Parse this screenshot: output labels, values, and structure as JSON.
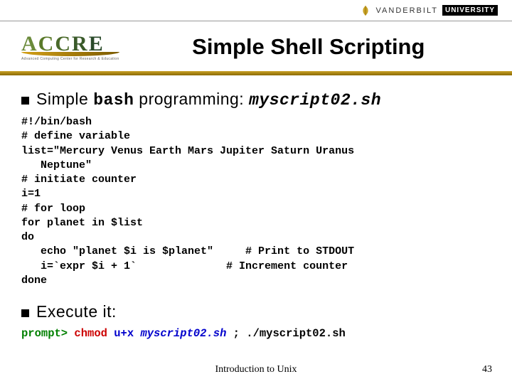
{
  "banner": {
    "vanderbilt": "VANDERBILT",
    "vu": "UNIVERSITY"
  },
  "logo": {
    "name": "ACCRE",
    "sub": "Advanced Computing Center\nfor Research & Education"
  },
  "title": "Simple Shell Scripting",
  "bullet1": {
    "prefix": "Simple ",
    "mono1": "bash",
    "mid": " programming: ",
    "mono2": "myscript02.sh"
  },
  "code": {
    "l1": "#!/bin/bash",
    "l2": "# define variable",
    "l3": "list=\"Mercury Venus Earth Mars Jupiter Saturn Uranus",
    "l3b": "   Neptune\"",
    "l4": "# initiate counter",
    "l5": "i=1",
    "l6": "# for loop",
    "l7": "for planet in $list",
    "l8": "do",
    "l9a": "   echo \"planet $i is $planet\"",
    "l9b": "     # Print to STDOUT",
    "l10a": "   i=`expr $i + 1`",
    "l10b": "              # Increment counter",
    "l11": "done"
  },
  "bullet2": "Execute it:",
  "exec": {
    "prompt": "prompt> ",
    "chmod": "chmod ",
    "flags": "u+x",
    "sp1": " ",
    "script1": "myscript02.sh",
    "sep": " ; ",
    "run": "./myscript02.sh"
  },
  "footer": {
    "title": "Introduction to Unix",
    "page": "43"
  }
}
